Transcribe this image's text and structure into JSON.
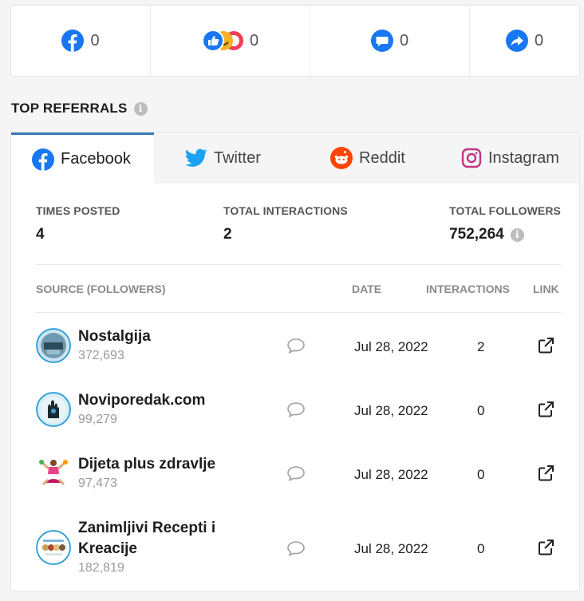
{
  "stats": {
    "facebook_count": "0",
    "reactions_count": "0",
    "comments_count": "0",
    "shares_count": "0"
  },
  "section": {
    "title": "TOP REFERRALS",
    "info_icon": "i"
  },
  "tabs": [
    {
      "label": "Facebook",
      "icon": "facebook-icon",
      "active": true
    },
    {
      "label": "Twitter",
      "icon": "twitter-icon",
      "active": false
    },
    {
      "label": "Reddit",
      "icon": "reddit-icon",
      "active": false
    },
    {
      "label": "Instagram",
      "icon": "instagram-icon",
      "active": false
    }
  ],
  "metrics": {
    "times_posted_label": "TIMES POSTED",
    "times_posted_value": "4",
    "total_interactions_label": "TOTAL INTERACTIONS",
    "total_interactions_value": "2",
    "total_followers_label": "TOTAL FOLLOWERS",
    "total_followers_value": "752,264"
  },
  "table": {
    "headers": {
      "source": "SOURCE (FOLLOWERS)",
      "date": "DATE",
      "interactions": "INTERACTIONS",
      "link": "LINK"
    },
    "rows": [
      {
        "name": "Nostalgija",
        "followers": "372,693",
        "date": "Jul 28, 2022",
        "interactions": "2"
      },
      {
        "name": "Noviporedak.com",
        "followers": "99,279",
        "date": "Jul 28, 2022",
        "interactions": "0"
      },
      {
        "name": "Dijeta plus zdravlje",
        "followers": "97,473",
        "date": "Jul 28, 2022",
        "interactions": "0"
      },
      {
        "name": "Zanimljivi Recepti i Kreacije",
        "followers": "182,819",
        "date": "Jul 28, 2022",
        "interactions": "0"
      }
    ]
  },
  "colors": {
    "facebook_blue": "#1877f2",
    "twitter_blue": "#1da1f2",
    "reddit_orange": "#ff4500",
    "instagram_pink": "#c13584",
    "active_tab_border": "#3b79b7"
  }
}
